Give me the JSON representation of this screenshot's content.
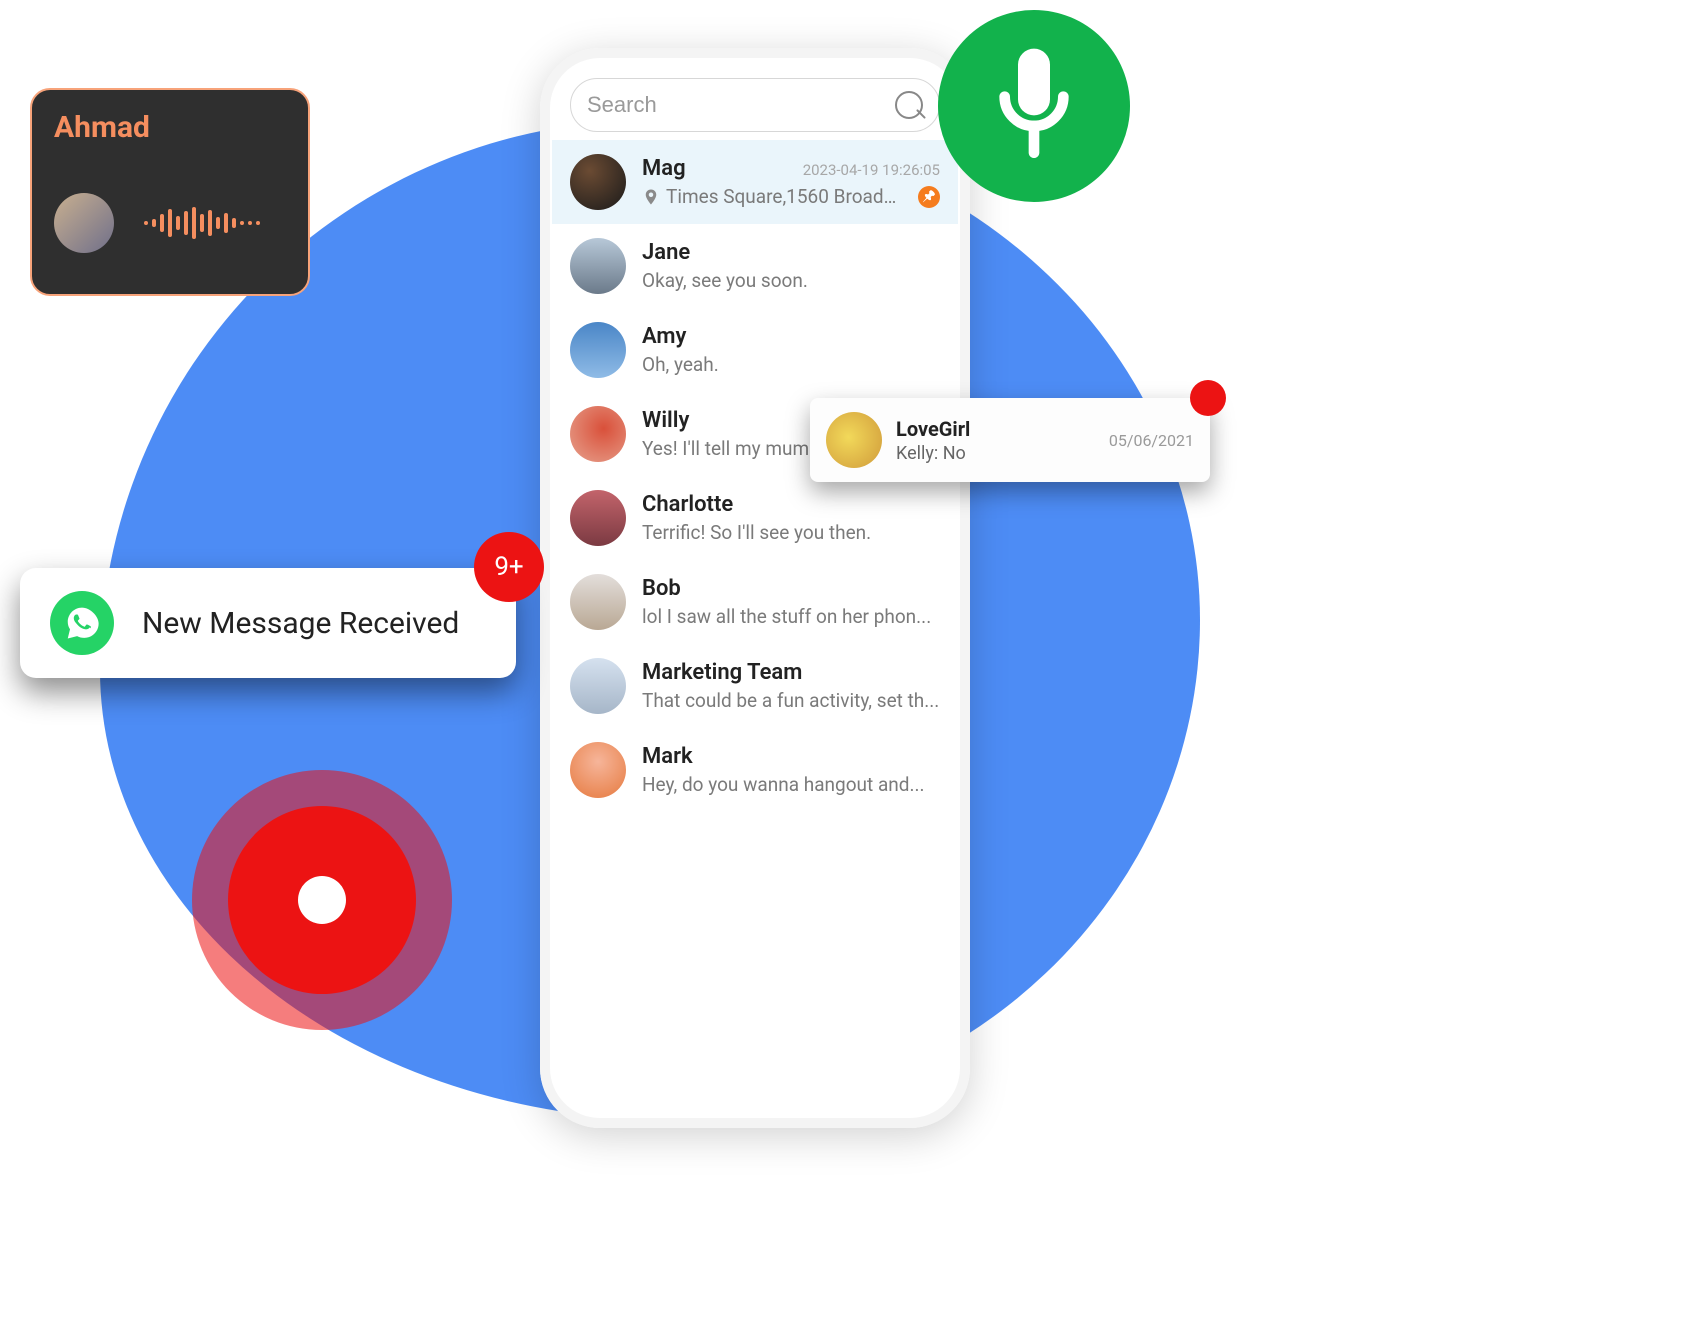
{
  "voice_card": {
    "name": "Ahmad"
  },
  "mic_button": {
    "icon_name": "mic-icon"
  },
  "search": {
    "placeholder": "Search"
  },
  "chats": [
    {
      "name": "Mag",
      "time": "2023-04-19 19:26:05",
      "preview": "Times Square,1560 Broadw ...",
      "has_location": true,
      "pinned": true,
      "active": true
    },
    {
      "name": "Jane",
      "time": "",
      "preview": "Okay, see you soon.",
      "has_location": false,
      "pinned": false,
      "active": false
    },
    {
      "name": "Amy",
      "time": "",
      "preview": "Oh, yeah.",
      "has_location": false,
      "pinned": false,
      "active": false
    },
    {
      "name": "Willy",
      "time": "",
      "preview": "Yes! I'll tell my mum. I'd love to ...",
      "has_location": false,
      "pinned": false,
      "active": false
    },
    {
      "name": "Charlotte",
      "time": "",
      "preview": "Terrific! So I'll see you then.",
      "has_location": false,
      "pinned": false,
      "active": false
    },
    {
      "name": "Bob",
      "time": "",
      "preview": "lol I saw all the stuff on her phon...",
      "has_location": false,
      "pinned": false,
      "active": false
    },
    {
      "name": "Marketing Team",
      "time": "",
      "preview": "That could be a fun activity, set th...",
      "has_location": false,
      "pinned": false,
      "active": false
    },
    {
      "name": "Mark",
      "time": "",
      "preview": "Hey, do you wanna hangout and...",
      "has_location": false,
      "pinned": false,
      "active": false
    }
  ],
  "lovegirl_popup": {
    "name": "LoveGirl",
    "message": "Kelly: No",
    "date": "05/06/2021"
  },
  "notification": {
    "label": "New Message Received",
    "badge": "9+"
  },
  "colors": {
    "blue": "#4d8cf5",
    "green": "#12b24c",
    "whatsapp": "#25d366",
    "red": "#ec1313",
    "orange": "#f57c1e",
    "voice_accent": "#f58e5f"
  }
}
